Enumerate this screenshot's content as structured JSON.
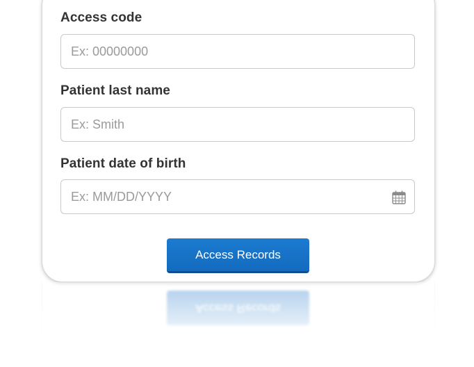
{
  "form": {
    "access_code": {
      "label": "Access code",
      "value": "",
      "placeholder": "Ex: 00000000"
    },
    "last_name": {
      "label": "Patient last name",
      "value": "",
      "placeholder": "Ex: Smith"
    },
    "dob": {
      "label": "Patient date of birth",
      "value": "",
      "placeholder": "Ex: MM/DD/YYYY",
      "icon": "calendar-icon"
    },
    "submit_label": "Access Records"
  },
  "colors": {
    "button": "#1673c6",
    "button_border": "#0d4f95",
    "label_text": "#333333",
    "placeholder": "#9a9a9a",
    "input_border": "#c9c9c9"
  }
}
